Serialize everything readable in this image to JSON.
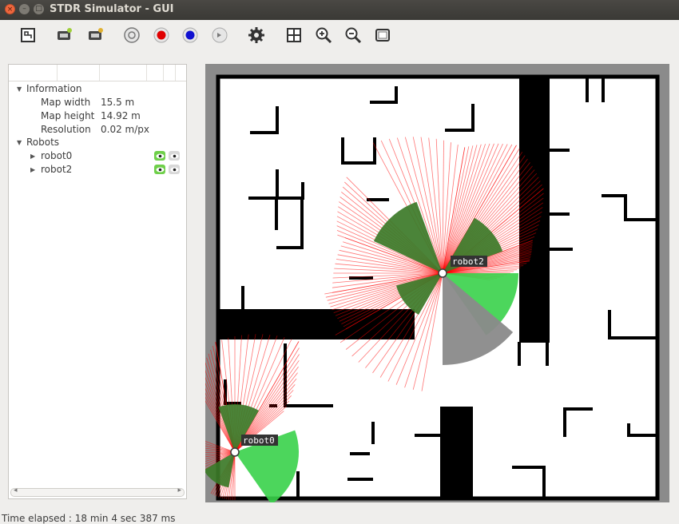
{
  "window": {
    "title": "STDR Simulator - GUI",
    "close_glyph": "×",
    "minimize_glyph": "–",
    "maximize_glyph": "□"
  },
  "toolbar": {
    "buttons": [
      {
        "name": "load-map-icon",
        "color": "#333"
      },
      {
        "name": "add-robot-icon",
        "color": "#333"
      },
      {
        "name": "load-robot-icon",
        "color": "#333"
      },
      {
        "name": "add-rfid-icon",
        "color": "#777"
      },
      {
        "name": "add-co2-source-icon",
        "color": "#e00000"
      },
      {
        "name": "add-thermal-source-icon",
        "color": "#1010d0"
      },
      {
        "name": "add-sound-source-icon",
        "color": "#777"
      },
      {
        "name": "settings-icon",
        "color": "#333"
      },
      {
        "name": "grid-icon",
        "color": "#333"
      },
      {
        "name": "zoom-in-icon",
        "color": "#333"
      },
      {
        "name": "zoom-out-icon",
        "color": "#333"
      },
      {
        "name": "adjust-map-icon",
        "color": "#333"
      }
    ]
  },
  "info_tree": {
    "information": {
      "label": "Information",
      "rows": [
        {
          "key": "Map width",
          "value": "15.5 m"
        },
        {
          "key": "Map height",
          "value": "14.92 m"
        },
        {
          "key": "Resolution",
          "value": "0.02 m/px"
        }
      ]
    },
    "robots": {
      "label": "Robots",
      "items": [
        {
          "label": "robot0"
        },
        {
          "label": "robot2"
        }
      ]
    },
    "expanded_glyph": "▼",
    "collapsed_glyph": "▶"
  },
  "map": {
    "robots": [
      {
        "label": "robot0"
      },
      {
        "label": "robot2"
      }
    ],
    "colors": {
      "wall": "#000000",
      "laser": "#ff0000",
      "sonar_dark": "#3c7a28",
      "sonar_light": "#39d24a",
      "sonar_gray": "#8a8a8a",
      "background": "#ffffff",
      "border": "#8b8b8b"
    }
  },
  "status_bar": {
    "text": "Time elapsed : 18 min 4 sec 387 ms"
  }
}
